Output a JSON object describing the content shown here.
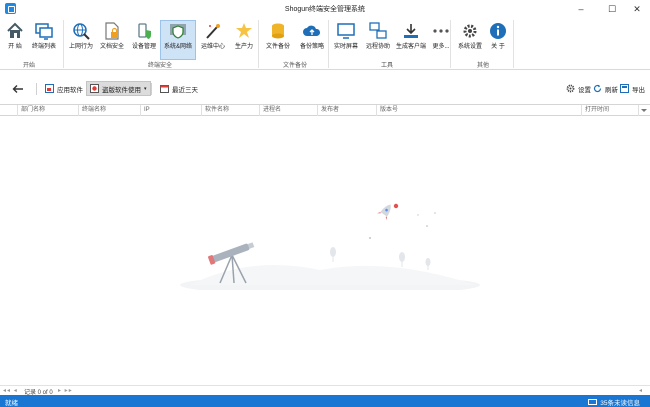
{
  "window": {
    "title": "Shogun终端安全管理系统",
    "minimize": "–",
    "maximize": "☐",
    "close": "✕"
  },
  "ribbon": {
    "groups": [
      {
        "label": "开始"
      },
      {
        "label": "终端安全"
      },
      {
        "label": "文件备份"
      },
      {
        "label": "工具"
      },
      {
        "label": "其他"
      }
    ],
    "items": [
      {
        "label": "开 始",
        "icon": "home-icon"
      },
      {
        "label": "终端列表",
        "icon": "monitor-list-icon"
      },
      {
        "label": "上网行为",
        "icon": "globe-search-icon"
      },
      {
        "label": "文档安全",
        "icon": "document-lock-icon"
      },
      {
        "label": "设备管理",
        "icon": "device-shield-icon"
      },
      {
        "label": "系统&网络",
        "icon": "network-shield-icon"
      },
      {
        "label": "运维中心",
        "icon": "magic-wand-icon"
      },
      {
        "label": "生产力",
        "icon": "star-person-icon"
      },
      {
        "label": "文件备份",
        "icon": "database-icon"
      },
      {
        "label": "备份策略",
        "icon": "cloud-upload-icon"
      },
      {
        "label": "实时屏幕",
        "icon": "screen-icon"
      },
      {
        "label": "远程协助",
        "icon": "remote-icon"
      },
      {
        "label": "生成客户端",
        "icon": "download-icon"
      },
      {
        "label": "更多...",
        "icon": "more-icon"
      },
      {
        "label": "系统设置",
        "icon": "gear-icon"
      },
      {
        "label": "关 于",
        "icon": "info-icon"
      }
    ]
  },
  "toolbar": {
    "app_software": "应用软件",
    "pirated_software": "盗版软件使用",
    "last_three_days": "最近三天",
    "settings": "设置",
    "refresh": "刷新",
    "export": "导出"
  },
  "grid": {
    "columns": [
      "部门名称",
      "终端名称",
      "IP",
      "软件名称",
      "进程名",
      "发布者",
      "版本号",
      "打开时间"
    ]
  },
  "navigator": {
    "first_prev": "◂◂ ◂",
    "record": "记录 0 of 0",
    "next_last": "▸ ▸▸",
    "right": "◂"
  },
  "status": {
    "left": "就绪",
    "unread": "35条未读信息"
  },
  "colors": {
    "accent": "#1976d2",
    "ribbon_active": "#cfe3f6"
  }
}
